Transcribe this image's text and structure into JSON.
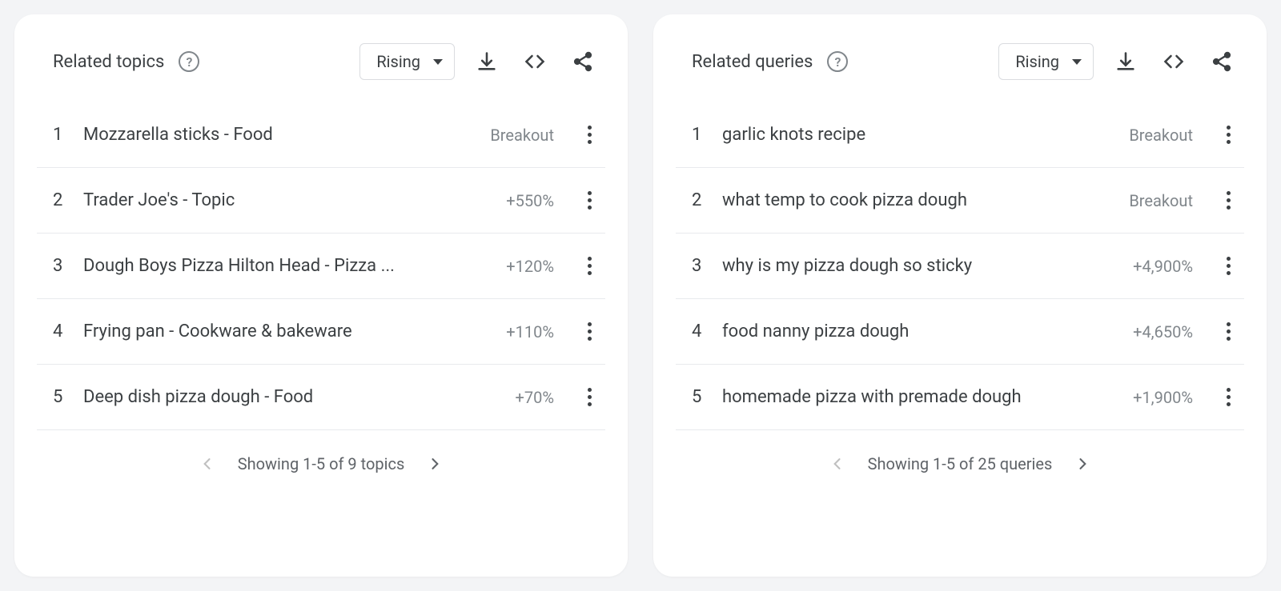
{
  "panels": [
    {
      "id": "topics",
      "title": "Related topics",
      "dropdown": "Rising",
      "rows": [
        {
          "rank": "1",
          "label": "Mozzarella sticks - Food",
          "value": "Breakout"
        },
        {
          "rank": "2",
          "label": "Trader Joe's - Topic",
          "value": "+550%"
        },
        {
          "rank": "3",
          "label": "Dough Boys Pizza Hilton Head - Pizza ...",
          "value": "+120%"
        },
        {
          "rank": "4",
          "label": "Frying pan - Cookware & bakeware",
          "value": "+110%"
        },
        {
          "rank": "5",
          "label": "Deep dish pizza dough - Food",
          "value": "+70%"
        }
      ],
      "footer": "Showing 1-5 of 9 topics"
    },
    {
      "id": "queries",
      "title": "Related queries",
      "dropdown": "Rising",
      "rows": [
        {
          "rank": "1",
          "label": "garlic knots recipe",
          "value": "Breakout"
        },
        {
          "rank": "2",
          "label": "what temp to cook pizza dough",
          "value": "Breakout"
        },
        {
          "rank": "3",
          "label": "why is my pizza dough so sticky",
          "value": "+4,900%"
        },
        {
          "rank": "4",
          "label": "food nanny pizza dough",
          "value": "+4,650%"
        },
        {
          "rank": "5",
          "label": "homemade pizza with premade dough",
          "value": "+1,900%"
        }
      ],
      "footer": "Showing 1-5 of 25 queries"
    }
  ]
}
